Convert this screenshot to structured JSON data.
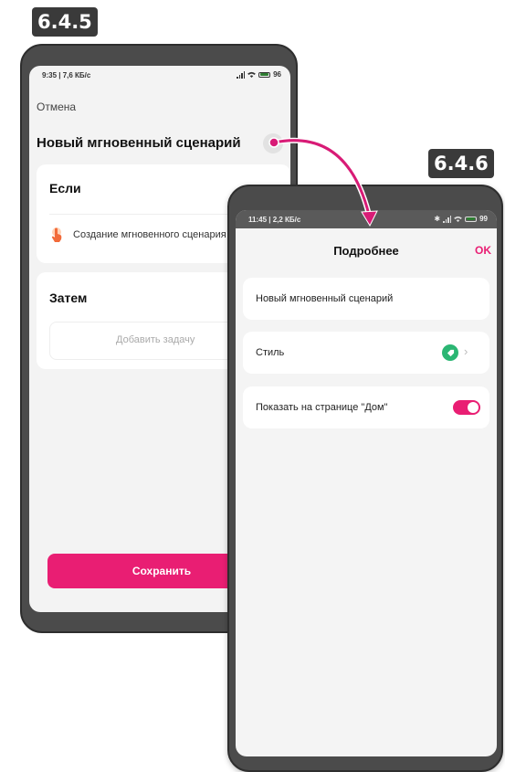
{
  "badges": {
    "left": "6.4.5",
    "right": "6.4.6"
  },
  "left_screen": {
    "status": {
      "time": "9:35 | 7,6 КБ/с",
      "battery": "96"
    },
    "cancel": "Отмена",
    "title": "Новый мгновенный сценарий",
    "more_icon": "more-dots-icon",
    "if_section": {
      "heading": "Если",
      "item": "Создание мгновенного сценария"
    },
    "then_section": {
      "heading": "Затем",
      "add_task": "Добавить задачу"
    },
    "save": "Сохранить"
  },
  "right_screen": {
    "status": {
      "time": "11:45 | 2,2 КБ/с",
      "battery": "99"
    },
    "header_title": "Подробнее",
    "ok": "OK",
    "name_field": "Новый мгновенный сценарий",
    "style_label": "Стиль",
    "show_home_label": "Показать на странице \"Дом\"",
    "show_home_enabled": true
  },
  "colors": {
    "accent": "#e91e73",
    "style_icon": "#2bb673",
    "frame": "#4b4b4b"
  }
}
